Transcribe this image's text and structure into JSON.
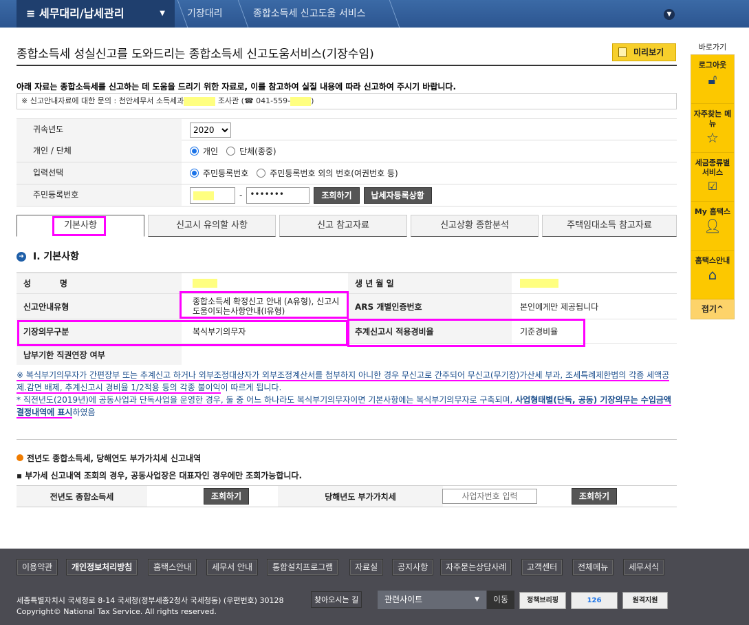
{
  "topbar": {
    "menu": "세무대리/납세관리",
    "breadcrumb": [
      "기장대리",
      "종합소득세 신고도움 서비스"
    ]
  },
  "page": {
    "title": "종합소득세 성실신고를 도와드리는 종합소득세 신고도움서비스(기장수임)",
    "preview": "미리보기",
    "notice": "아래 자료는 종합소득세를 신고하는 데 도움을 드리기 위한 자료로, 이를 참고하여 실질 내용에 따라 신고하여 주시기 바랍니다.",
    "inquiry_prefix": "※ 신고안내자료에 대한 문의 : 천안세무서 소득세과",
    "inquiry_mid": "조사관 (☎ 041-559-",
    "inquiry_end": ")"
  },
  "form": {
    "year_label": "귀속년도",
    "year_value": "2020",
    "type_label": "개인 / 단체",
    "type_options": [
      "개인",
      "단체(종중)"
    ],
    "input_label": "입력선택",
    "input_options": [
      "주민등록번호",
      "주민등록번호 외의 번호(여권번호 등)"
    ],
    "rrn_label": "주민등록번호",
    "rrn_back": "•••••••",
    "query": "조회하기",
    "status": "납세자등록상황"
  },
  "tabs": [
    "기본사항",
    "신고시 유의할 사항",
    "신고 참고자료",
    "신고상황 종합분석",
    "주택임대소득 참고자료"
  ],
  "section1": {
    "title": "Ⅰ. 기본사항",
    "rows": [
      {
        "l1": "성          명",
        "v1": "",
        "l2": "생 년 월 일",
        "v2": ""
      },
      {
        "l1": "신고안내유형",
        "v1": "종합소득세 확정신고 안내 (A유형), 신고시도움이되는사항안내(I유형)",
        "l2": "ARS 개별인증번호",
        "v2": "본인에게만 제공됩니다"
      },
      {
        "l1": "기장의무구분",
        "v1": "복식부기의무자",
        "l2": "추계신고시 적용경비율",
        "v2": "기준경비율"
      },
      {
        "l1": "납부기한 직권연장 여부",
        "v1": "",
        "l2": "",
        "v2": ""
      }
    ],
    "note1a": "※ 복식부기의무자가 간편장부 또는 추계신고 하거나 외부조정대상자가 외부조정계산서를 첨부하지 아니한 경우 무신고로 간주되어 무신고(무기장)가산세 부과, 조세특례제한법의 각종 세액공제.감면 배제",
    "note1b": ", 추계신고시 경비율 1/2적용 등의 각종 불이익",
    "note1c": "이 따르게 됩니다.",
    "note2a": "* 직전년도(2019년)에 공동사업과 단독사업을 운영한 경우, 둘 중 어느 하나라도 복식부기의무자이면 기본사항에는 복식부기의무자로 구축되며, ",
    "note2b": "사업형태별(단독, 공동) 기장의무는 수입금액 결정내역에 표시",
    "note2c": "하였음"
  },
  "section2": {
    "title": "전년도 종합소득세, 당해연도 부가가치세 신고내역",
    "note": "부가세 신고내역 조회의 경우, 공동사업장은 대표자인 경우에만 조회가능합니다.",
    "prev_label": "전년도 종합소득세",
    "cur_label": "당해년도 부가가치세",
    "biz_placeholder": "사업자번호 입력",
    "query": "조회하기"
  },
  "sidebar": {
    "title": "바로가기",
    "items": [
      "로그아웃",
      "자주찾는 메뉴",
      "세금종류별 서비스",
      "My 홈택스",
      "홈택스안내"
    ],
    "fold": "접기^"
  },
  "footer": {
    "links": [
      "이용약관",
      "개인정보처리방침",
      "홈택스안내",
      "세무서 안내",
      "통합설치프로그램",
      "자료실",
      "공지사항",
      "자주묻는상담사례",
      "고객센터",
      "전체메뉴",
      "세무서식"
    ],
    "address": "세종특별자치시 국세청로 8-14 국세청(정부세종2청사 국세청동) (우편번호) 30128",
    "findway": "찾아오시는 길",
    "copyright": "Copyright© National Tax Service. All rights reserved.",
    "related": "관련사이트",
    "go": "이동",
    "icons": [
      "정책브리핑",
      "126",
      "원격지원"
    ]
  },
  "colors": {
    "highlight": "#ff00ff",
    "accent": "#fcc800",
    "header": "#2c5590"
  }
}
